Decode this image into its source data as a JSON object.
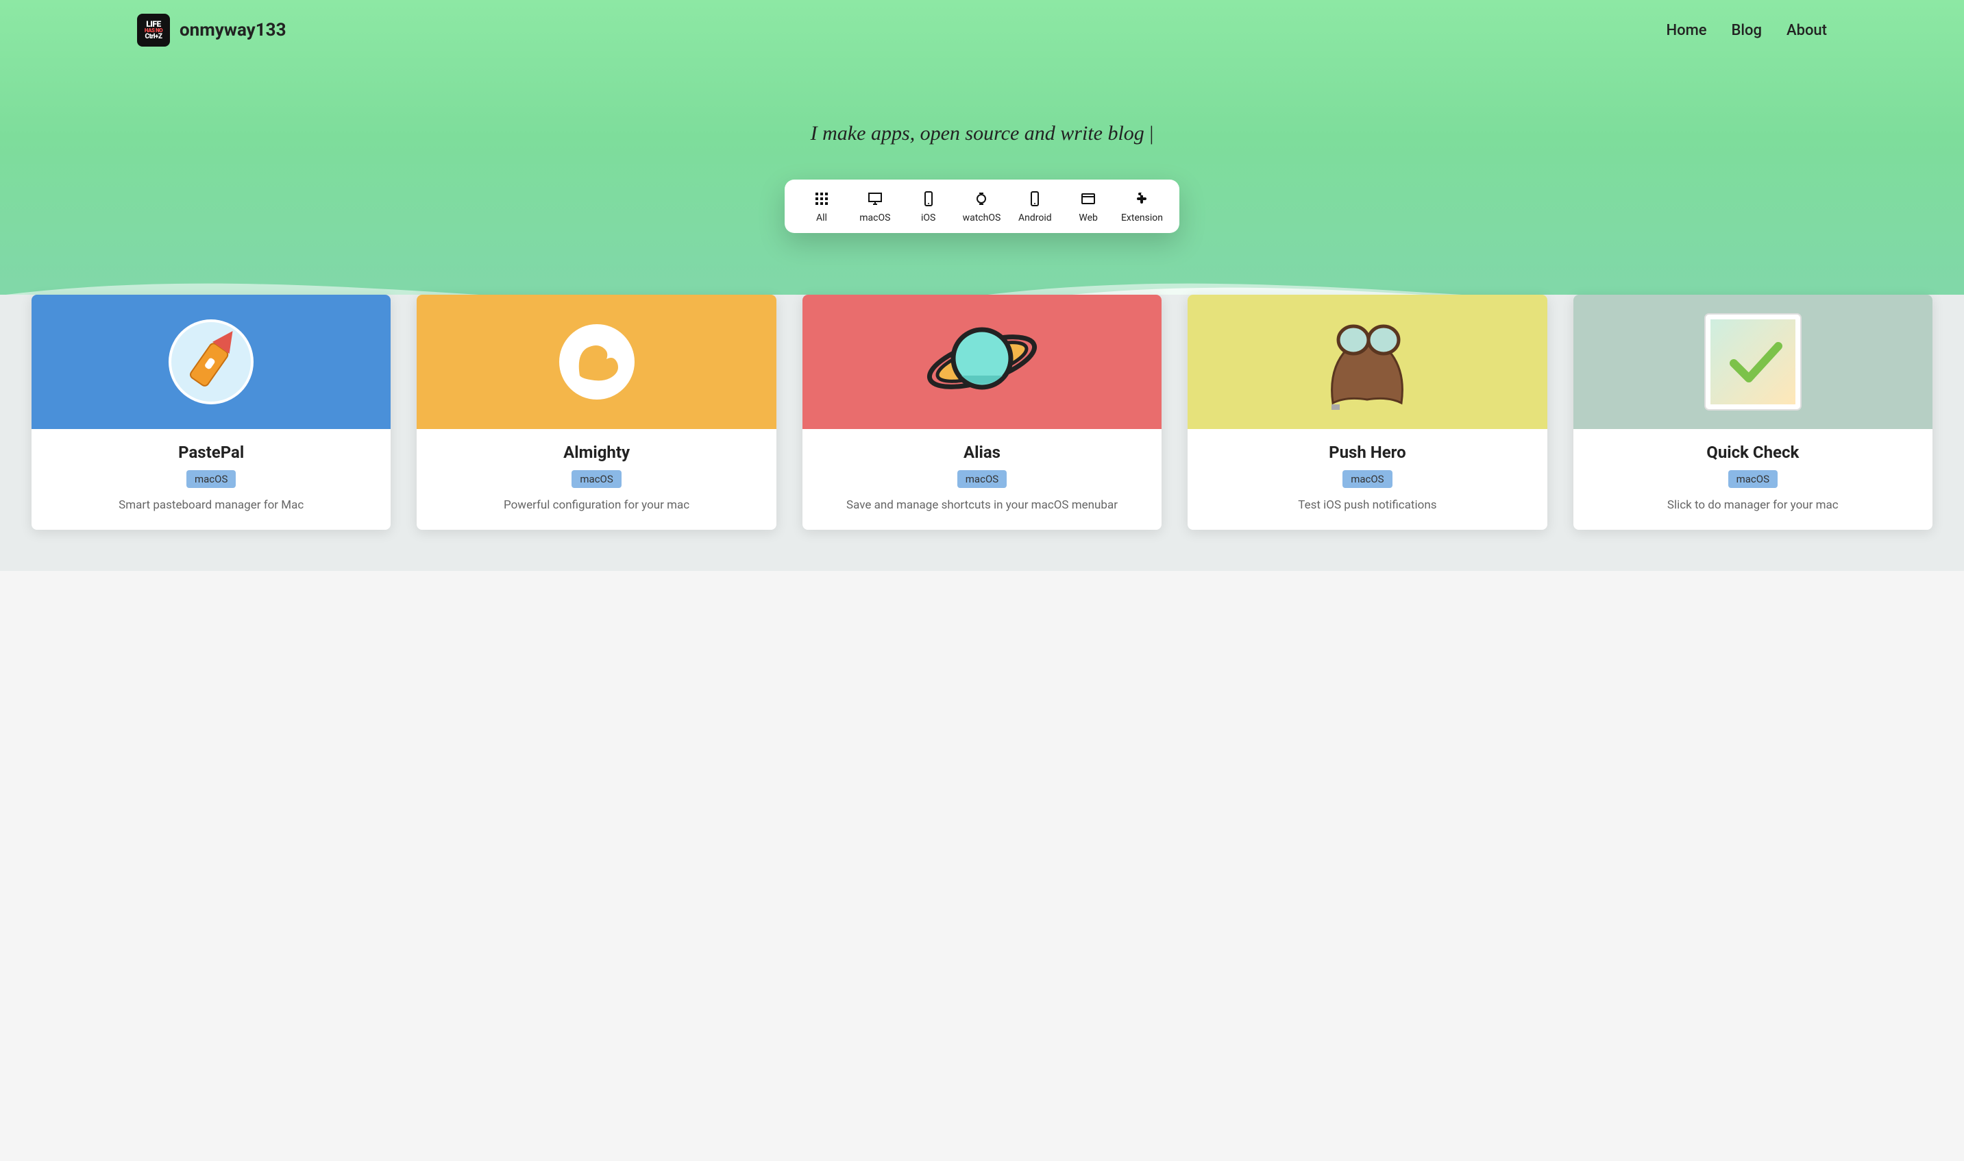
{
  "brand": {
    "name": "onmyway133",
    "logo_l1": "LIFE",
    "logo_l2a": "HAS",
    "logo_l2b": "NO",
    "logo_l3": "Ctrl+Z"
  },
  "nav": {
    "home": "Home",
    "blog": "Blog",
    "about": "About"
  },
  "tagline": "I make apps, open source and write blog",
  "filters": {
    "all": "All",
    "macos": "macOS",
    "ios": "iOS",
    "watchos": "watchOS",
    "android": "Android",
    "web": "Web",
    "extension": "Extension"
  },
  "cards": [
    {
      "title": "PastePal",
      "platform": "macOS",
      "desc": "Smart pasteboard manager for Mac"
    },
    {
      "title": "Almighty",
      "platform": "macOS",
      "desc": "Powerful configuration for your mac"
    },
    {
      "title": "Alias",
      "platform": "macOS",
      "desc": "Save and manage shortcuts in your macOS menubar"
    },
    {
      "title": "Push Hero",
      "platform": "macOS",
      "desc": "Test iOS push notifications"
    },
    {
      "title": "Quick Check",
      "platform": "macOS",
      "desc": "Slick to do manager for your mac"
    }
  ]
}
